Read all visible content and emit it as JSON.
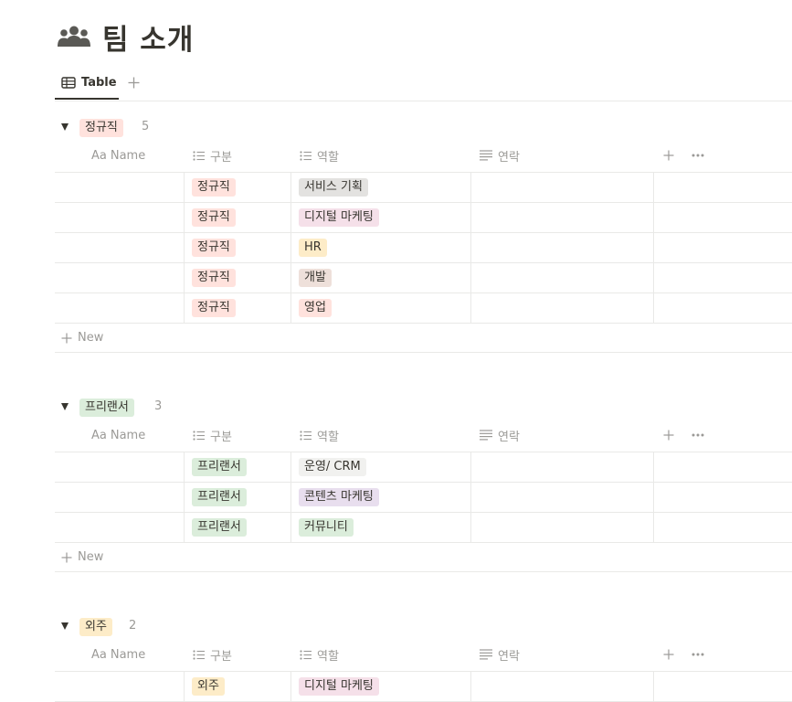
{
  "page": {
    "title": "팀 소개",
    "icon": "people-group-icon"
  },
  "tabs": {
    "active_label": "Table",
    "add_icon": "plus-icon"
  },
  "columns": {
    "name": "Name",
    "name_prefix": "Aa",
    "category": "구분",
    "role": "역할",
    "contact": "연락"
  },
  "new_label": "New",
  "colors": {
    "text": "#37352f",
    "muted": "#9b9a97",
    "border": "#e9e9e7",
    "red_tag": "#ffe2dd",
    "green_tag": "#dbeddb",
    "yellow_tag": "#fdecc8",
    "gray_tag": "#e3e2e0",
    "pink_tag": "#f5e0e9",
    "brown_tag": "#eee0da",
    "purple_tag": "#e8deee",
    "light_gray_tag": "#f1f1ef"
  },
  "groups": [
    {
      "label": "정규직",
      "count": "5",
      "rows": [
        {
          "category": "정규직",
          "role": "서비스 기획"
        },
        {
          "category": "정규직",
          "role": "디지털 마케팅"
        },
        {
          "category": "정규직",
          "role": "HR"
        },
        {
          "category": "정규직",
          "role": "개발"
        },
        {
          "category": "정규직",
          "role": "영업"
        }
      ]
    },
    {
      "label": "프리랜서",
      "count": "3",
      "rows": [
        {
          "category": "프리랜서",
          "role": "운영/ CRM"
        },
        {
          "category": "프리랜서",
          "role": "콘텐츠 마케팅"
        },
        {
          "category": "프리랜서",
          "role": "커뮤니티"
        }
      ]
    },
    {
      "label": "외주",
      "count": "2",
      "rows": [
        {
          "category": "외주",
          "role": "디지털 마케팅"
        }
      ]
    }
  ]
}
